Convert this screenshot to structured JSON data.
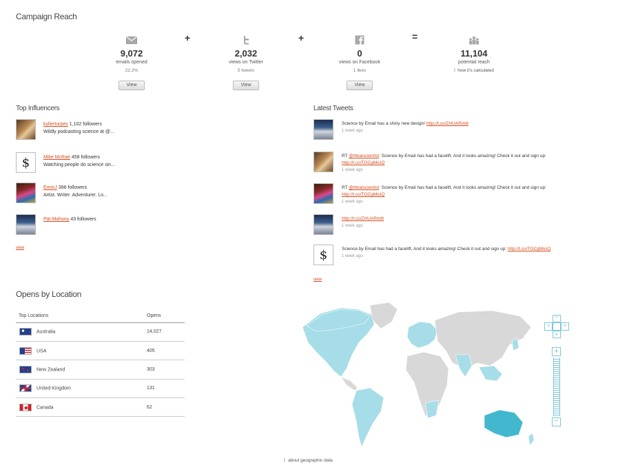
{
  "campaign": {
    "title": "Campaign Reach",
    "metrics": [
      {
        "icon": "envelope-icon",
        "value": "9,072",
        "label": "emails opened",
        "sub": "22.2%",
        "button": "View"
      },
      {
        "icon": "twitter-icon",
        "value": "2,032",
        "label": "views on Twitter",
        "sub": "5 tweets",
        "button": "View"
      },
      {
        "icon": "facebook-icon",
        "value": "0",
        "label": "views on Facebook",
        "sub": "1 likes",
        "button": "View"
      },
      {
        "icon": "people-icon",
        "value": "11,104",
        "label": "potential reach",
        "sub": "how it's calculated"
      }
    ],
    "operators": [
      "+",
      "+",
      "="
    ]
  },
  "influencers": {
    "title": "Top Influencers",
    "items": [
      {
        "name": "kylierturpes",
        "followers": "1,102 followers",
        "bio": "Wildly podcasting science at @..."
      },
      {
        "name": "Mike McRae",
        "followers": "458 followers",
        "bio": "Watching people do science sin..."
      },
      {
        "name": "EmmJ",
        "followers": "386 followers",
        "bio": "Artist. Writer. Adventurer. Lo..."
      },
      {
        "name": "Pat Mahony",
        "followers": "43 followers",
        "bio": ""
      }
    ],
    "view_link": "view"
  },
  "tweets": {
    "title": "Latest Tweets",
    "items": [
      {
        "prefix": "Science by Email has a shiny new design!",
        "mention": "",
        "text": "",
        "link": "http://t.co/ZHUARmlit",
        "time": "1 week ago"
      },
      {
        "prefix": "RT",
        "mention": "@thkalscientist",
        "text": ": Science by Email has had a facelift. And it looks amazing! Check it out and sign up:",
        "link": "http://t.co/TOCgMiciQ",
        "time": "1 week ago"
      },
      {
        "prefix": "RT",
        "mention": "@thkalscientist",
        "text": ": Science by Email has had a facelift. And it looks amazing! Check it out and sign up:",
        "link": "http://t.co/TOCgMiciQ",
        "time": "1 week ago"
      },
      {
        "prefix": "",
        "mention": "",
        "text": "",
        "link": "http://t.co/ZHUARmlit",
        "time": "1 week ago"
      },
      {
        "prefix": "Science by Email has had a facelift. And it looks amazing! Check it out and sign up:",
        "mention": "",
        "text": "",
        "link": "http://t.co/TOCgMiciQ",
        "time": "1 week ago"
      }
    ],
    "view_link": "view"
  },
  "locations": {
    "title": "Opens by Location",
    "columns": [
      "Top Locations",
      "Opens"
    ],
    "rows": [
      {
        "flag": "f-au",
        "country": "Australia",
        "opens": "14,027"
      },
      {
        "flag": "f-us",
        "country": "USA",
        "opens": "405"
      },
      {
        "flag": "f-nz",
        "country": "New Zealand",
        "opens": "303"
      },
      {
        "flag": "f-uk",
        "country": "United Kingdom",
        "opens": "131"
      },
      {
        "flag": "f-ca",
        "country": "Canada",
        "opens": "62"
      }
    ]
  },
  "map": {
    "footer": "about geographic data",
    "colors": {
      "land": "#d8d8d8",
      "opened": "#a6dde8",
      "top": "#42b8cf"
    }
  }
}
